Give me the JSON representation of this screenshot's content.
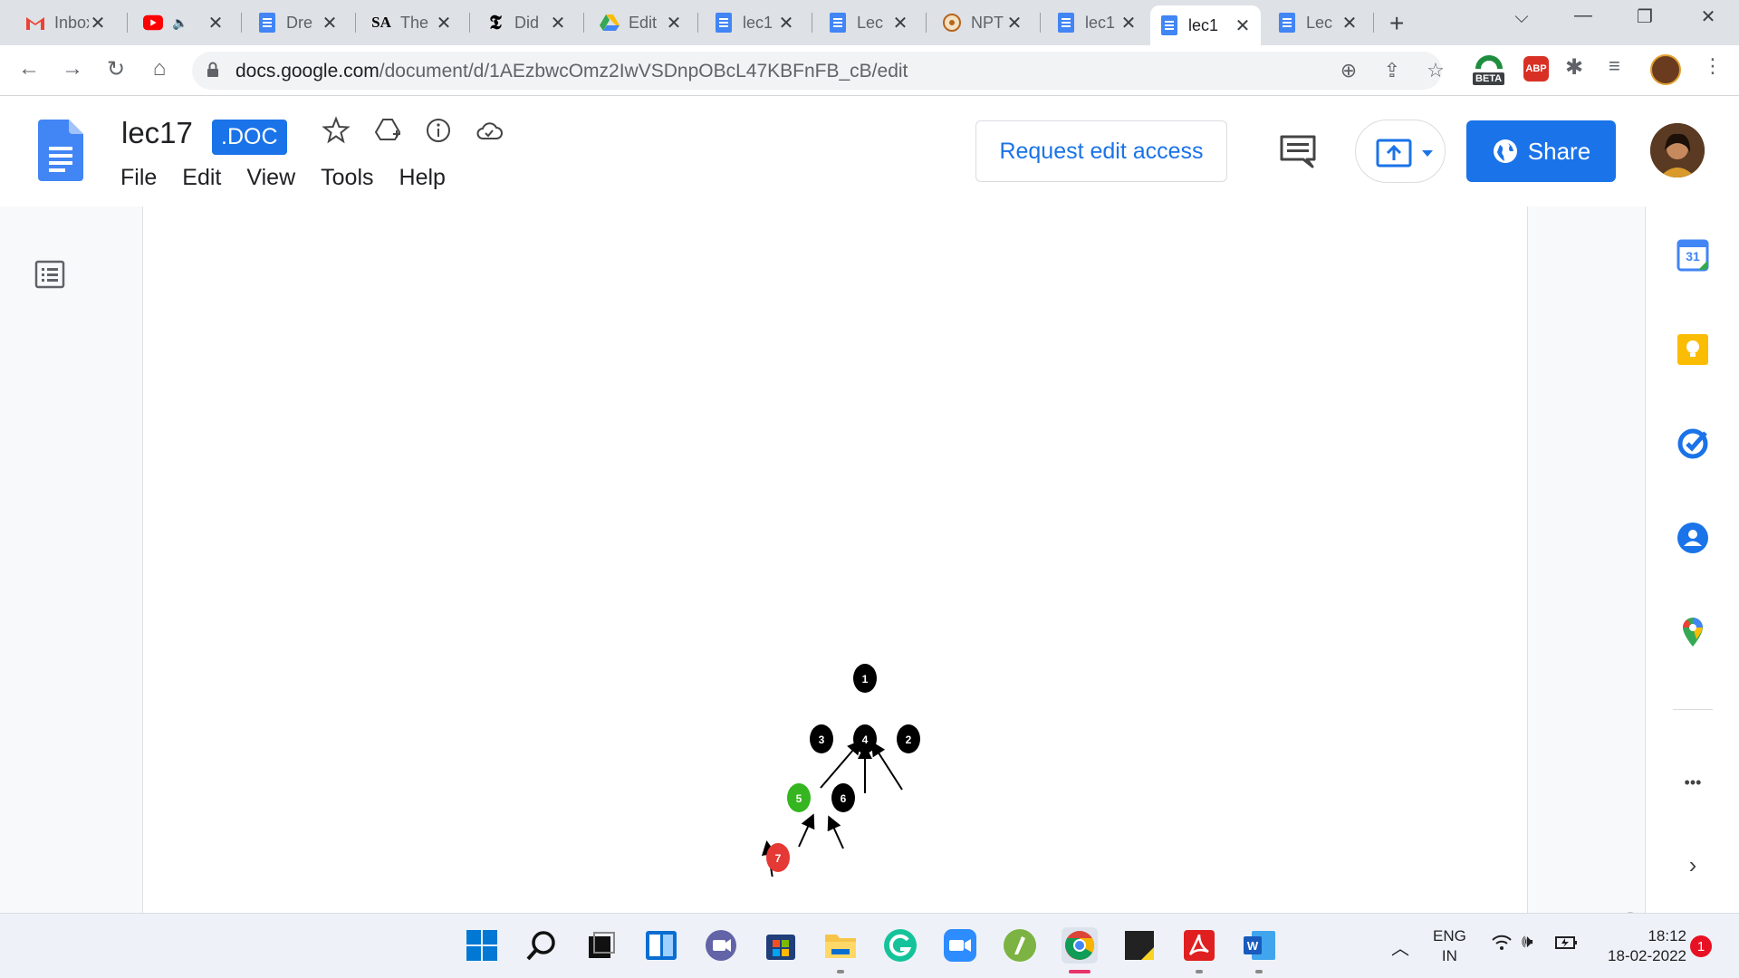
{
  "browser": {
    "tabs": [
      {
        "title": "Inbox",
        "icon": "gmail-icon"
      },
      {
        "title": "",
        "icon": "youtube-icon",
        "muted": true
      },
      {
        "title": "Dre",
        "icon": "docs-icon"
      },
      {
        "title": "The",
        "icon": "sa-icon"
      },
      {
        "title": "Did",
        "icon": "nyt-icon"
      },
      {
        "title": "Edit",
        "icon": "drive-icon"
      },
      {
        "title": "lec1",
        "icon": "docs-icon"
      },
      {
        "title": "Lec",
        "icon": "docs-icon"
      },
      {
        "title": "NPT",
        "icon": "nptel-icon"
      },
      {
        "title": "lec1",
        "icon": "docs-icon"
      },
      {
        "title": "lec1",
        "icon": "docs-icon",
        "active": true
      },
      {
        "title": "Lec",
        "icon": "docs-icon"
      }
    ],
    "url_host": "docs.google.com",
    "url_path": "/document/d/1AEzbwcOmz2IwVSDnpOBcL47KBFnFB_cB/edit",
    "extension_badge": "BETA",
    "abp_label": "ABP"
  },
  "doc": {
    "title": "lec17",
    "badge": ".DOC",
    "menu": [
      "File",
      "Edit",
      "View",
      "Tools",
      "Help"
    ],
    "request_edit_label": "Request edit access",
    "share_label": "Share"
  },
  "diagram": {
    "nodes": [
      {
        "id": "1",
        "color": "#000000"
      },
      {
        "id": "3",
        "color": "#000000"
      },
      {
        "id": "4",
        "color": "#000000"
      },
      {
        "id": "2",
        "color": "#000000"
      },
      {
        "id": "5",
        "color": "#35b51f"
      },
      {
        "id": "6",
        "color": "#000000"
      },
      {
        "id": "7",
        "color": "#e53935"
      }
    ]
  },
  "sidepanel": {
    "calendar_day": "31",
    "more_label": "•••"
  },
  "taskbar": {
    "lang_top": "ENG",
    "lang_bottom": "IN",
    "time": "18:12",
    "date": "18-02-2022",
    "notification_count": "1"
  },
  "colors": {
    "accent": "#1a73e8",
    "tabstrip": "#dee1e6"
  }
}
